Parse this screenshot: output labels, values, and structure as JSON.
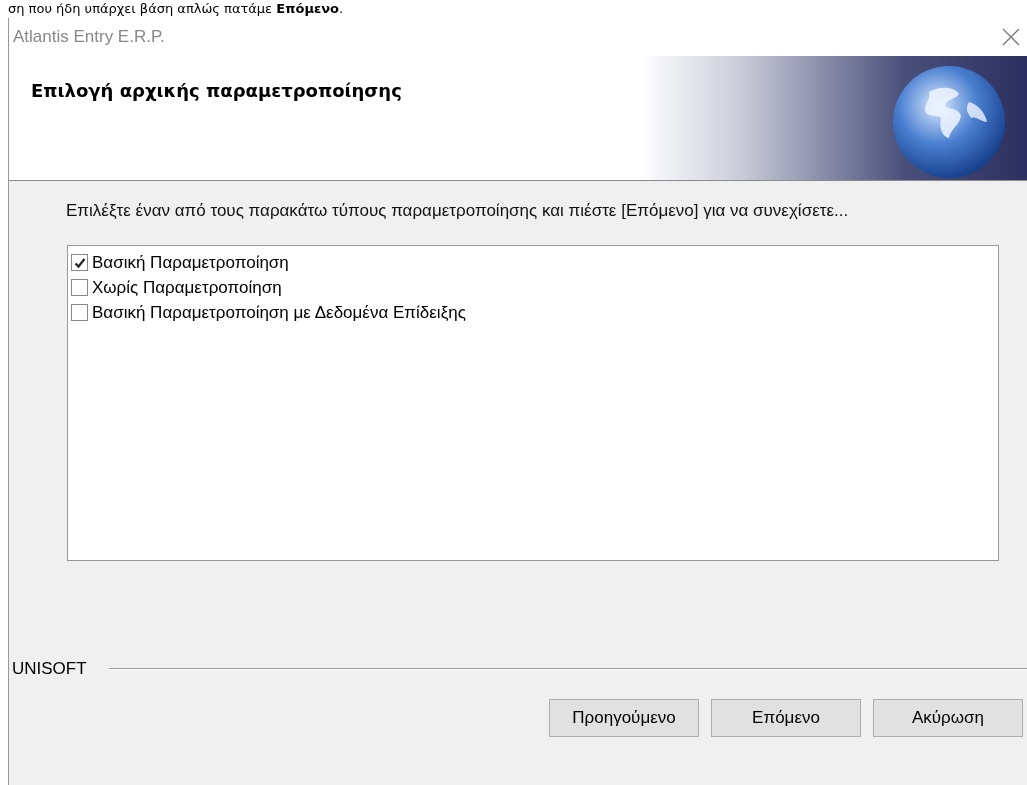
{
  "context_text": "ση που ήδη υπάρχει βάση απλώς πατάμε **Επόμενο**.",
  "window": {
    "title": "Atlantis Entry E.R.P."
  },
  "header": {
    "title": "Επιλογή αρχικής παραμετροποίησης"
  },
  "instructions": "Επιλέξτε έναν από τους παρακάτω τύπους παραμετροποίησης και πιέστε [Επόμενο] για να συνεχίσετε...",
  "options": [
    {
      "label": "Βασική Παραμετροποίηση",
      "checked": true
    },
    {
      "label": "Χωρίς Παραμετροποίηση",
      "checked": false
    },
    {
      "label": "Βασική Παραμετροποίηση με Δεδομένα Επίδειξης",
      "checked": false
    }
  ],
  "footer": {
    "brand": "UNISOFT"
  },
  "buttons": [
    "Προηγούμενο",
    "Επόμενο",
    "Ακύρωση"
  ]
}
